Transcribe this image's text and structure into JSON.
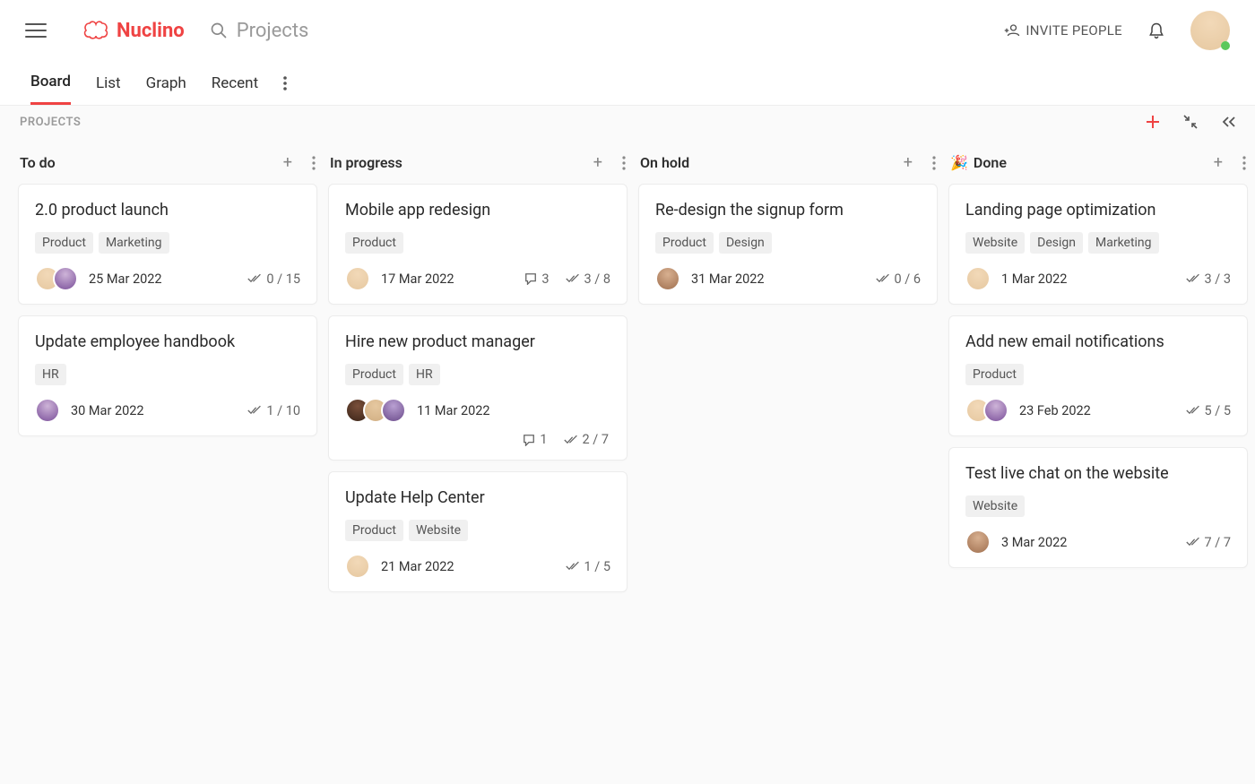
{
  "header": {
    "brand": "Nuclino",
    "search_placeholder": "Projects",
    "invite_label": "INVITE PEOPLE"
  },
  "viewtabs": [
    "Board",
    "List",
    "Graph",
    "Recent"
  ],
  "active_viewtab": 0,
  "board_label": "PROJECTS",
  "columns": [
    {
      "title": "To do",
      "emoji": "",
      "cards": [
        {
          "title": "2.0 product launch",
          "tags": [
            "Product",
            "Marketing"
          ],
          "avatars": [
            "ava-1",
            "ava-2"
          ],
          "date": "25 Mar 2022",
          "comments": null,
          "checks": "0 / 15",
          "overflow": false
        },
        {
          "title": "Update employee handbook",
          "tags": [
            "HR"
          ],
          "avatars": [
            "ava-2"
          ],
          "date": "30 Mar 2022",
          "comments": null,
          "checks": "1 / 10",
          "overflow": false
        }
      ]
    },
    {
      "title": "In progress",
      "emoji": "",
      "cards": [
        {
          "title": "Mobile app redesign",
          "tags": [
            "Product"
          ],
          "avatars": [
            "ava-1"
          ],
          "date": "17 Mar 2022",
          "comments": "3",
          "checks": "3 / 8",
          "overflow": false
        },
        {
          "title": "Hire new product manager",
          "tags": [
            "Product",
            "HR"
          ],
          "avatars": [
            "ava-3",
            "ava-4",
            "ava-5"
          ],
          "date": "11 Mar 2022",
          "comments": "1",
          "checks": "2 / 7",
          "overflow": true
        },
        {
          "title": "Update Help Center",
          "tags": [
            "Product",
            "Website"
          ],
          "avatars": [
            "ava-1"
          ],
          "date": "21 Mar 2022",
          "comments": null,
          "checks": "1 / 5",
          "overflow": false
        }
      ]
    },
    {
      "title": "On hold",
      "emoji": "",
      "cards": [
        {
          "title": "Re-design the signup form",
          "tags": [
            "Product",
            "Design"
          ],
          "avatars": [
            "ava-6"
          ],
          "date": "31 Mar 2022",
          "comments": null,
          "checks": "0 / 6",
          "overflow": false
        }
      ]
    },
    {
      "title": "Done",
      "emoji": "🎉",
      "cards": [
        {
          "title": "Landing page optimization",
          "tags": [
            "Website",
            "Design",
            "Marketing"
          ],
          "avatars": [
            "ava-1"
          ],
          "date": "1 Mar 2022",
          "comments": null,
          "checks": "3 / 3",
          "overflow": false
        },
        {
          "title": "Add new email notifications",
          "tags": [
            "Product"
          ],
          "avatars": [
            "ava-1",
            "ava-2"
          ],
          "date": "23 Feb 2022",
          "comments": null,
          "checks": "5 / 5",
          "overflow": false
        },
        {
          "title": "Test live chat on the website",
          "tags": [
            "Website"
          ],
          "avatars": [
            "ava-6"
          ],
          "date": "3 Mar 2022",
          "comments": null,
          "checks": "7 / 7",
          "overflow": false
        }
      ]
    }
  ]
}
